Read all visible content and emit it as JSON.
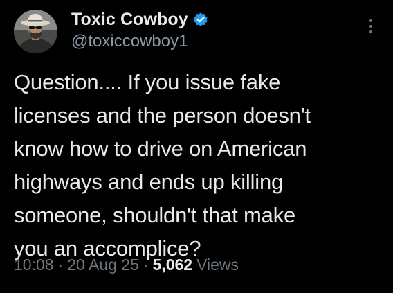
{
  "author": {
    "display_name": "Toxic Cowboy",
    "handle": "@toxiccowboy1",
    "verified": true,
    "verified_color": "#1d9bf0",
    "avatar_icon": "cowboy-avatar"
  },
  "tweet": {
    "text": "Question.... If you issue fake\nlicenses and the person doesn't\nknow how to drive on American\nhighways and ends up killing\nsomeone, shouldn't that make\nyou an accomplice?"
  },
  "meta": {
    "time": "10:08",
    "date": "20 Aug 25",
    "separator": "·",
    "views_count": "5,062",
    "views_label": "Views"
  },
  "theme": {
    "background": "#000000",
    "text": "#e7e9ea",
    "secondary": "#6e767d"
  },
  "icons": {
    "more": "more-vertical-icon",
    "verified": "verified-badge-icon"
  }
}
